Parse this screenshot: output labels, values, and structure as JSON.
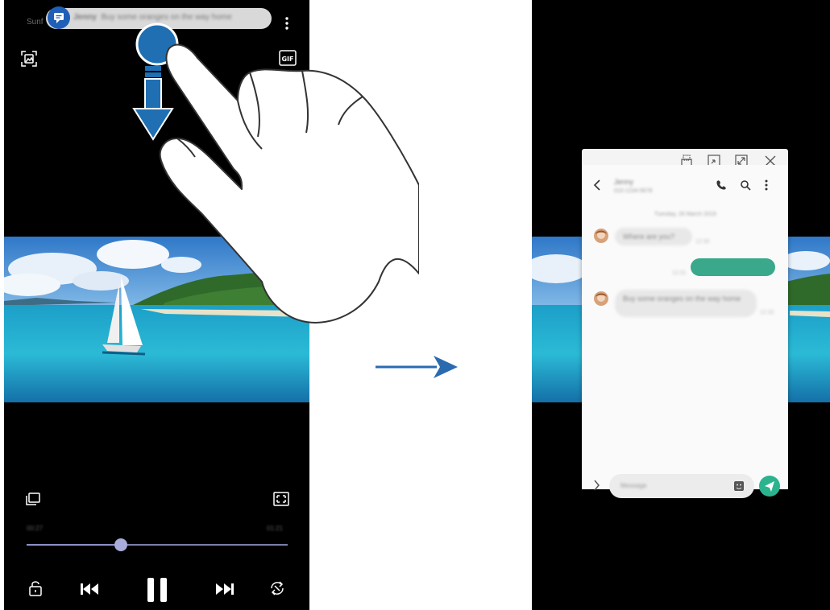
{
  "left_player": {
    "notification": {
      "sender": "Jenny",
      "message": "Buy some oranges on the way home"
    },
    "title": "Sunf",
    "time_elapsed": "00:27",
    "time_total": "01:21",
    "progress": 0.36
  },
  "popup_chat": {
    "contact_name": "Jenny",
    "contact_number": "010-1234-5678",
    "date_header": "Tuesday, 26 March 2019",
    "messages": [
      {
        "direction": "received",
        "text": "Where are you?",
        "time": "12:30"
      },
      {
        "direction": "sent",
        "text": "",
        "time": "12:31"
      },
      {
        "direction": "received",
        "text": "Buy some oranges on the way home",
        "time": "12:32"
      }
    ],
    "input_placeholder": "Message"
  },
  "colors": {
    "notification_badge": "#1f5fb8",
    "gesture_circle": "#1f6fb2",
    "sent_bubble": "#3aa88a",
    "send_button": "#2bb38e",
    "seek_thumb": "#a9acdb",
    "arrow": "#2a6bb0"
  }
}
